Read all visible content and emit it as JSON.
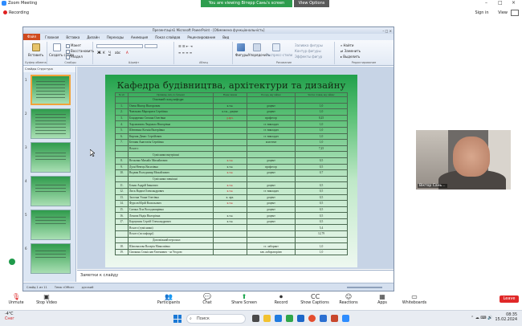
{
  "zoom": {
    "title": "Zoom Meeting",
    "viewing_banner": "You are viewing Вітерр Сань's screen",
    "view_options": "View Options",
    "recording": "Recording",
    "signin": "Sign in",
    "view": "View",
    "leave": "Leave",
    "controls": [
      {
        "label": "Unmute",
        "icon": "microphone-muted-icon"
      },
      {
        "label": "Stop Video",
        "icon": "video-camera-icon"
      },
      {
        "label": "Participants",
        "icon": "participants-icon"
      },
      {
        "label": "Chat",
        "icon": "chat-icon"
      },
      {
        "label": "Share Screen",
        "icon": "share-screen-icon"
      },
      {
        "label": "Record",
        "icon": "record-icon"
      },
      {
        "label": "Show Captions",
        "icon": "captions-icon"
      },
      {
        "label": "Reactions",
        "icon": "reactions-icon"
      },
      {
        "label": "Apps",
        "icon": "apps-icon"
      },
      {
        "label": "Whiteboards",
        "icon": "whiteboards-icon"
      }
    ],
    "participants_count": "2",
    "webcam_name": "Віктор Сань..."
  },
  "powerpoint": {
    "window_title": "Презентація1 Microsoft PowerPoint - [Обмежена функціональність]",
    "file_tab": "Файл",
    "tabs": [
      "Главная",
      "Вставка",
      "Дизайн",
      "Переходы",
      "Анимация",
      "Показ слайдов",
      "Рецензирование",
      "Вид"
    ],
    "ribbon": {
      "paste": "Вставить",
      "create_slide": "Создать слайд",
      "layout": "Макет",
      "reset": "Восстановить",
      "section": "Раздел",
      "group_clipboard": "Буфер обмена",
      "group_slides": "Слайды",
      "group_font": "Шрифт",
      "group_paragraph": "Абзац",
      "group_drawing": "Рисование",
      "group_editing": "Редактирование",
      "shapes": "Фигуры",
      "arrange": "Упорядочить",
      "quick_styles": "Экспресс-стили",
      "fill": "Заливка фигуры",
      "outline": "Контур фигуры",
      "effects": "Эффекты фигур",
      "find": "Найти",
      "replace": "Заменить",
      "select": "Выделить"
    },
    "slides_panel_tabs": "Слайды  Структура",
    "slide_numbers": [
      "1",
      "2",
      "3",
      "4",
      "5",
      "6"
    ],
    "notes_placeholder": "Заметки к слайду",
    "status": {
      "slide": "Слайд 1 из 11",
      "theme": "Тема «Office»",
      "lang": "русский"
    }
  },
  "slide": {
    "title": "Кафедра будівництва, архітектури та дизайну",
    "headers": [
      "№ з/п",
      "Прізвище, ім'я, по батькові",
      "Вчене звання",
      "Посада, яку займає",
      "Частка ставки, яку займає"
    ],
    "rows": [
      {
        "n": "",
        "name": "Основний склад кафедри",
        "title": "",
        "position": "",
        "rate": "",
        "section": true
      },
      {
        "n": "1.",
        "name": "Опеш Віктор Вікторович",
        "title": "к.т.н.",
        "position": "доцент",
        "rate": "1,0",
        "red": false
      },
      {
        "n": "2.",
        "name": "Чмельова Маргарита Сергіївна",
        "title": "к.т.н., доцент",
        "position": "доцент",
        "rate": "1,0",
        "red": false
      },
      {
        "n": "3.",
        "name": "Бондаренко Сюзана Олегівна",
        "title": "д.арх.",
        "position": "професор",
        "rate": "0,25",
        "red": true
      },
      {
        "n": "4.",
        "name": "Харлампова Людмила Вікторівна",
        "title": "",
        "position": "ст. викладач",
        "rate": "1,0",
        "red": false
      },
      {
        "n": "5.",
        "name": "Шевченко Ксенія Валеріївна",
        "title": "",
        "position": "ст. викладач",
        "rate": "1,0",
        "red": false
      },
      {
        "n": "6.",
        "name": "Кирчик Денис Сергійович",
        "title": "",
        "position": "ст. викладач",
        "rate": "1,0",
        "red": false
      },
      {
        "n": "7.",
        "name": "Бесман Анастасія Сергіївна",
        "title": "",
        "position": "асистент",
        "rate": "1,0",
        "red": false
      },
      {
        "n": "",
        "name": "Всього:",
        "title": "",
        "position": "",
        "rate": "7,25",
        "red": false
      },
      {
        "n": "",
        "name": "Сумісники внутрішні",
        "title": "",
        "position": "",
        "rate": "",
        "section": true
      },
      {
        "n": "8.",
        "name": "Вельєвко Михайл Михайлович",
        "title": "к.т.н.",
        "position": "доцент",
        "rate": "0,5",
        "red": true
      },
      {
        "n": "9.",
        "name": "Дуля Невець Василівна",
        "title": "к.т.н.",
        "position": "професор",
        "rate": "0,5",
        "red": false
      },
      {
        "n": "10.",
        "name": "Водвик Володимир Михайлович",
        "title": "к.т.н.",
        "position": "доцент",
        "rate": "0,7",
        "red": true
      },
      {
        "n": "",
        "name": "Сумісники зовнішні",
        "title": "",
        "position": "",
        "rate": "",
        "section": true
      },
      {
        "n": "11.",
        "name": "Бокан Андрій Іванович",
        "title": "к.т.н.",
        "position": "доцент",
        "rate": "0,5",
        "red": true
      },
      {
        "n": "12.",
        "name": "Лиск Вадим Олександрович",
        "title": "к.т.н.",
        "position": "ст. викладач",
        "rate": "0,5",
        "red": true
      },
      {
        "n": "13.",
        "name": "Залочна Уляна Олегівна",
        "title": "к. арх.",
        "position": "доцент",
        "rate": "0,5",
        "red": false
      },
      {
        "n": "14.",
        "name": "Фурсов Юрій Васильович",
        "title": "к.т.н.",
        "position": "доцент",
        "rate": "0,5",
        "red": true
      },
      {
        "n": "15.",
        "name": "Сагина Ліза Володимирівна",
        "title": "",
        "position": "доцент",
        "rate": "0,5",
        "red": false
      },
      {
        "n": "16.",
        "name": "Ломова Надія Вікторівна",
        "title": "к.т.н.",
        "position": "доцент",
        "rate": "0,5",
        "red": false
      },
      {
        "n": "17.",
        "name": "Карпушин Сергій Олександрович",
        "title": "к.т.н.",
        "position": "доцент",
        "rate": "0,5",
        "red": false
      },
      {
        "n": "",
        "name": "Всього (сумісники)",
        "title": "",
        "position": "",
        "rate": "5,4",
        "red": false
      },
      {
        "n": "",
        "name": "Всього (по кафедрі)",
        "title": "",
        "position": "",
        "rate": "12,79",
        "red": false
      },
      {
        "n": "",
        "name": "Допоміжний персонал",
        "title": "",
        "position": "",
        "rate": "",
        "section": true
      },
      {
        "n": "18.",
        "name": "Шаповалова Валерія Миколаївна",
        "title": "",
        "position": "ст. лаборант",
        "rate": "1,0",
        "red": false
      },
      {
        "n": "19.",
        "name": "Сівоконь Станіслав Євгенович - за Угодою",
        "title": "",
        "position": "зав. лабораторією",
        "rate": "1,0",
        "red": false
      }
    ]
  },
  "taskbar": {
    "weather_temp": "-4°C",
    "weather_desc": "Снег",
    "search": "Поиск",
    "time": "08:35",
    "date": "15.02.2024"
  },
  "colors": {
    "zoom_green": "#2e9d4e",
    "leave_red": "#e02828",
    "ppt_file_tab": "#d04a1e"
  }
}
